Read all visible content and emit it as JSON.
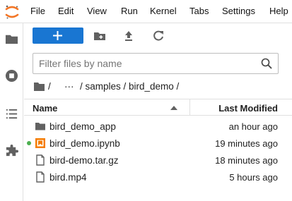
{
  "menubar": {
    "items": [
      "File",
      "Edit",
      "View",
      "Run",
      "Kernel",
      "Tabs",
      "Settings",
      "Help"
    ]
  },
  "colors": {
    "accent": "#1976d2",
    "logo_orange": "#f37626",
    "notebook_orange": "#f57c00",
    "running_dot": "#4caf50",
    "icon_gray": "#616161"
  },
  "sidebar": {
    "icons": [
      "folder-icon",
      "running-kernels-icon",
      "table-of-contents-icon",
      "extension-manager-icon"
    ]
  },
  "toolbar": {
    "new_label": "+",
    "buttons": [
      "new-folder-icon",
      "upload-icon",
      "refresh-icon"
    ]
  },
  "filter": {
    "placeholder": "Filter files by name",
    "value": ""
  },
  "breadcrumbs": {
    "root_sep": "/",
    "ellipsis": "···",
    "path": "/ samples / bird_demo /"
  },
  "table": {
    "columns": {
      "name": "Name",
      "modified": "Last Modified"
    },
    "rows": [
      {
        "name": "bird_demo_app",
        "modified": "an hour ago",
        "type": "folder",
        "running": false
      },
      {
        "name": "bird_demo.ipynb",
        "modified": "19 minutes ago",
        "type": "notebook",
        "running": true
      },
      {
        "name": "bird-demo.tar.gz",
        "modified": "18 minutes ago",
        "type": "file",
        "running": false
      },
      {
        "name": "bird.mp4",
        "modified": "5 hours ago",
        "type": "file",
        "running": false
      }
    ]
  }
}
